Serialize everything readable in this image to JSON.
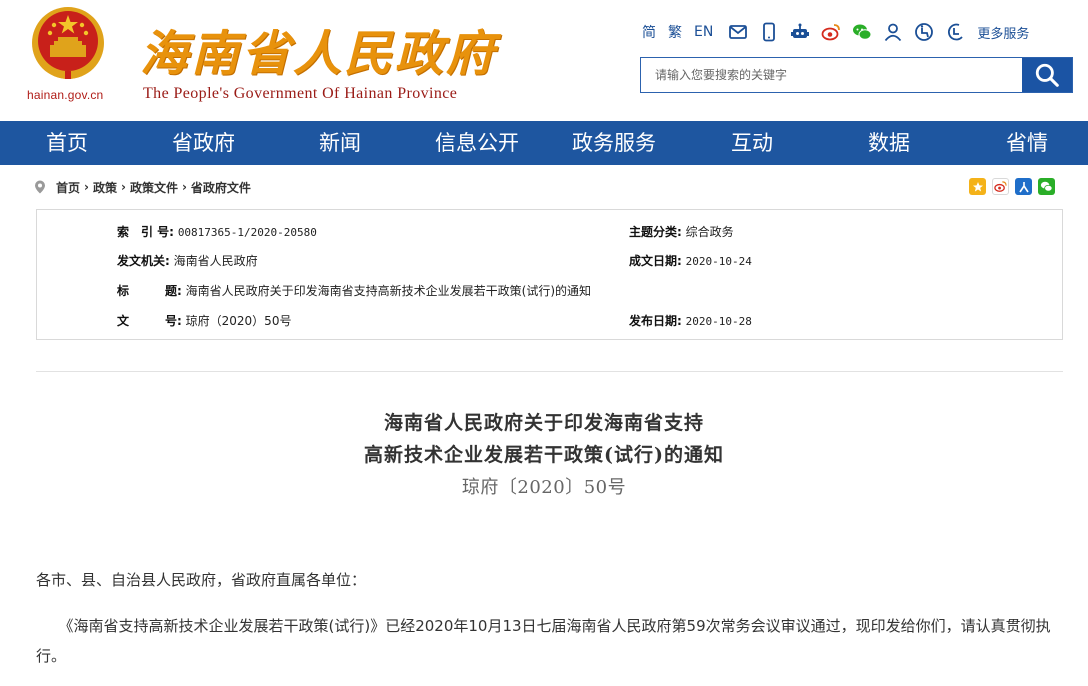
{
  "header": {
    "domain": "hainan.gov.cn",
    "title": "海南省人民政府",
    "subtitle": "The People's Government Of Hainan Province"
  },
  "toolbar": {
    "lang_simplified": "简",
    "lang_traditional": "繁",
    "lang_english": "EN",
    "icons": [
      "mail-icon",
      "mobile-icon",
      "robot-icon",
      "weibo-icon",
      "wechat-icon",
      "user-icon",
      "accessibility-icon",
      "elderly-mode-icon"
    ],
    "more_services": "更多服务"
  },
  "search": {
    "placeholder": "请输入您要搜索的关键字"
  },
  "nav": {
    "items": [
      {
        "label": "首页"
      },
      {
        "label": "省政府"
      },
      {
        "label": "新闻"
      },
      {
        "label": "信息公开"
      },
      {
        "label": "政务服务"
      },
      {
        "label": "互动"
      },
      {
        "label": "数据"
      },
      {
        "label": "省情"
      }
    ]
  },
  "breadcrumb": {
    "items": [
      "首页",
      "政策",
      "政策文件",
      "省政府文件"
    ],
    "separator": "›"
  },
  "share": {
    "icons": [
      "qzone-icon",
      "weibo-share-icon",
      "renren-icon",
      "wechat-share-icon"
    ]
  },
  "info": {
    "index_label": "索　引 号:",
    "index_value": "00817365-1/2020-20580",
    "issuer_label": "发文机关:",
    "issuer_value": "海南省人民政府",
    "title_label": "标　　　题:",
    "title_value": "海南省人民政府关于印发海南省支持高新技术企业发展若干政策(试行)的通知",
    "docno_label": "文　　　号:",
    "docno_value": "琼府（2020）50号",
    "category_label": "主题分类:",
    "category_value": "综合政务",
    "created_label": "成文日期:",
    "created_value": "2020-10-24",
    "published_label": "发布日期:",
    "published_value": "2020-10-28"
  },
  "document": {
    "title_line1": "海南省人民政府关于印发海南省支持",
    "title_line2": "高新技术企业发展若干政策(试行)的通知",
    "number": "琼府〔2020〕50号",
    "salutation": "各市、县、自治县人民政府，省政府直属各单位：",
    "paragraph1": "　　《海南省支持高新技术企业发展若干政策(试行)》已经2020年10月13日七届海南省人民政府第59次常务会议审议通过，现印发给你们，请认真贯彻执行。"
  },
  "colors": {
    "nav_blue": "#1e56a0",
    "title_orange": "#e8920c",
    "subtitle_red": "#9a1b16",
    "link_blue": "#1b4f96"
  }
}
